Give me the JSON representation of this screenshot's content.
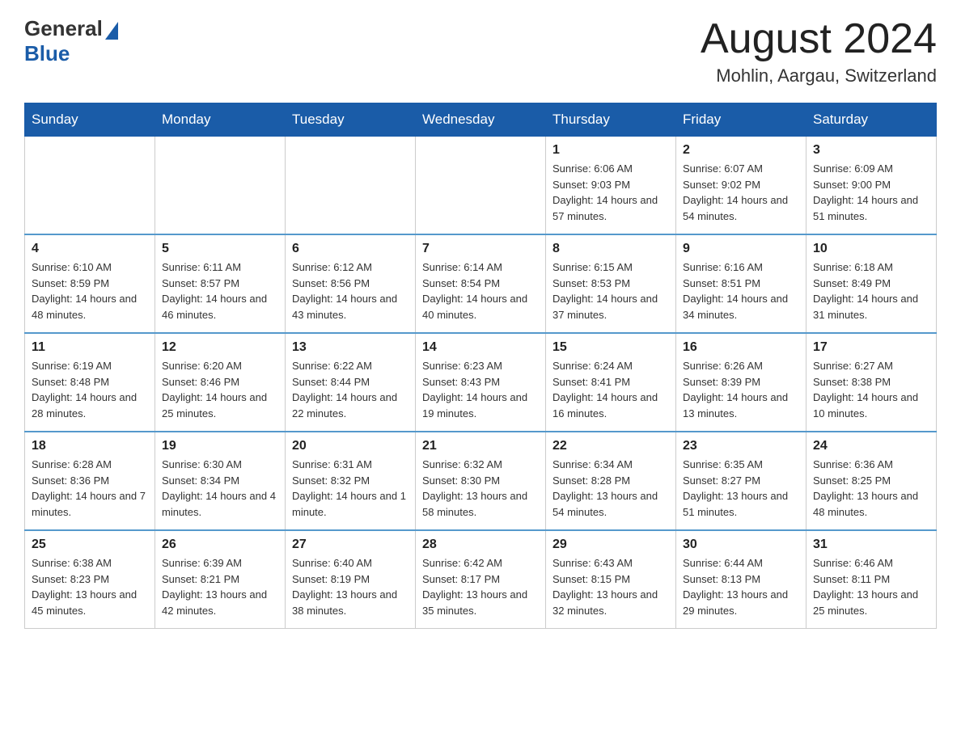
{
  "header": {
    "logo_general": "General",
    "logo_blue": "Blue",
    "month_year": "August 2024",
    "location": "Mohlin, Aargau, Switzerland"
  },
  "days_of_week": [
    "Sunday",
    "Monday",
    "Tuesday",
    "Wednesday",
    "Thursday",
    "Friday",
    "Saturday"
  ],
  "weeks": [
    [
      {
        "day": "",
        "info": ""
      },
      {
        "day": "",
        "info": ""
      },
      {
        "day": "",
        "info": ""
      },
      {
        "day": "",
        "info": ""
      },
      {
        "day": "1",
        "info": "Sunrise: 6:06 AM\nSunset: 9:03 PM\nDaylight: 14 hours and 57 minutes."
      },
      {
        "day": "2",
        "info": "Sunrise: 6:07 AM\nSunset: 9:02 PM\nDaylight: 14 hours and 54 minutes."
      },
      {
        "day": "3",
        "info": "Sunrise: 6:09 AM\nSunset: 9:00 PM\nDaylight: 14 hours and 51 minutes."
      }
    ],
    [
      {
        "day": "4",
        "info": "Sunrise: 6:10 AM\nSunset: 8:59 PM\nDaylight: 14 hours and 48 minutes."
      },
      {
        "day": "5",
        "info": "Sunrise: 6:11 AM\nSunset: 8:57 PM\nDaylight: 14 hours and 46 minutes."
      },
      {
        "day": "6",
        "info": "Sunrise: 6:12 AM\nSunset: 8:56 PM\nDaylight: 14 hours and 43 minutes."
      },
      {
        "day": "7",
        "info": "Sunrise: 6:14 AM\nSunset: 8:54 PM\nDaylight: 14 hours and 40 minutes."
      },
      {
        "day": "8",
        "info": "Sunrise: 6:15 AM\nSunset: 8:53 PM\nDaylight: 14 hours and 37 minutes."
      },
      {
        "day": "9",
        "info": "Sunrise: 6:16 AM\nSunset: 8:51 PM\nDaylight: 14 hours and 34 minutes."
      },
      {
        "day": "10",
        "info": "Sunrise: 6:18 AM\nSunset: 8:49 PM\nDaylight: 14 hours and 31 minutes."
      }
    ],
    [
      {
        "day": "11",
        "info": "Sunrise: 6:19 AM\nSunset: 8:48 PM\nDaylight: 14 hours and 28 minutes."
      },
      {
        "day": "12",
        "info": "Sunrise: 6:20 AM\nSunset: 8:46 PM\nDaylight: 14 hours and 25 minutes."
      },
      {
        "day": "13",
        "info": "Sunrise: 6:22 AM\nSunset: 8:44 PM\nDaylight: 14 hours and 22 minutes."
      },
      {
        "day": "14",
        "info": "Sunrise: 6:23 AM\nSunset: 8:43 PM\nDaylight: 14 hours and 19 minutes."
      },
      {
        "day": "15",
        "info": "Sunrise: 6:24 AM\nSunset: 8:41 PM\nDaylight: 14 hours and 16 minutes."
      },
      {
        "day": "16",
        "info": "Sunrise: 6:26 AM\nSunset: 8:39 PM\nDaylight: 14 hours and 13 minutes."
      },
      {
        "day": "17",
        "info": "Sunrise: 6:27 AM\nSunset: 8:38 PM\nDaylight: 14 hours and 10 minutes."
      }
    ],
    [
      {
        "day": "18",
        "info": "Sunrise: 6:28 AM\nSunset: 8:36 PM\nDaylight: 14 hours and 7 minutes."
      },
      {
        "day": "19",
        "info": "Sunrise: 6:30 AM\nSunset: 8:34 PM\nDaylight: 14 hours and 4 minutes."
      },
      {
        "day": "20",
        "info": "Sunrise: 6:31 AM\nSunset: 8:32 PM\nDaylight: 14 hours and 1 minute."
      },
      {
        "day": "21",
        "info": "Sunrise: 6:32 AM\nSunset: 8:30 PM\nDaylight: 13 hours and 58 minutes."
      },
      {
        "day": "22",
        "info": "Sunrise: 6:34 AM\nSunset: 8:28 PM\nDaylight: 13 hours and 54 minutes."
      },
      {
        "day": "23",
        "info": "Sunrise: 6:35 AM\nSunset: 8:27 PM\nDaylight: 13 hours and 51 minutes."
      },
      {
        "day": "24",
        "info": "Sunrise: 6:36 AM\nSunset: 8:25 PM\nDaylight: 13 hours and 48 minutes."
      }
    ],
    [
      {
        "day": "25",
        "info": "Sunrise: 6:38 AM\nSunset: 8:23 PM\nDaylight: 13 hours and 45 minutes."
      },
      {
        "day": "26",
        "info": "Sunrise: 6:39 AM\nSunset: 8:21 PM\nDaylight: 13 hours and 42 minutes."
      },
      {
        "day": "27",
        "info": "Sunrise: 6:40 AM\nSunset: 8:19 PM\nDaylight: 13 hours and 38 minutes."
      },
      {
        "day": "28",
        "info": "Sunrise: 6:42 AM\nSunset: 8:17 PM\nDaylight: 13 hours and 35 minutes."
      },
      {
        "day": "29",
        "info": "Sunrise: 6:43 AM\nSunset: 8:15 PM\nDaylight: 13 hours and 32 minutes."
      },
      {
        "day": "30",
        "info": "Sunrise: 6:44 AM\nSunset: 8:13 PM\nDaylight: 13 hours and 29 minutes."
      },
      {
        "day": "31",
        "info": "Sunrise: 6:46 AM\nSunset: 8:11 PM\nDaylight: 13 hours and 25 minutes."
      }
    ]
  ]
}
